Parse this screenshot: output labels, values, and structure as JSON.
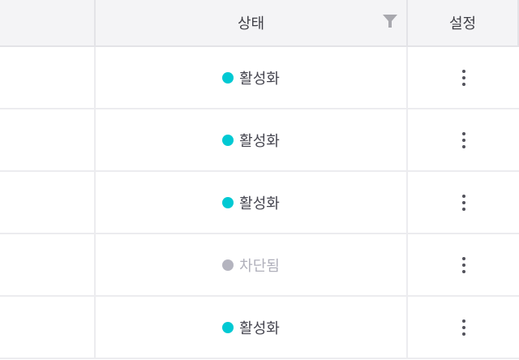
{
  "table": {
    "columns": [
      {
        "key": "blank",
        "label": ""
      },
      {
        "key": "status",
        "label": "상태",
        "filter_icon": "filter-icon"
      },
      {
        "key": "settings",
        "label": "설정"
      }
    ],
    "rows": [
      {
        "status": "활성화",
        "state": "active"
      },
      {
        "status": "활성화",
        "state": "active"
      },
      {
        "status": "활성화",
        "state": "active"
      },
      {
        "status": "차단됨",
        "state": "blocked"
      },
      {
        "status": "활성화",
        "state": "active"
      }
    ],
    "row_action_icon": "more-vertical-icon"
  },
  "colors": {
    "active_dot": "#00c9d3",
    "blocked_dot": "#b4b4bf",
    "active_text": "#45454f",
    "blocked_text": "#b0b0bb",
    "filter_icon": "#a8a8ae"
  }
}
